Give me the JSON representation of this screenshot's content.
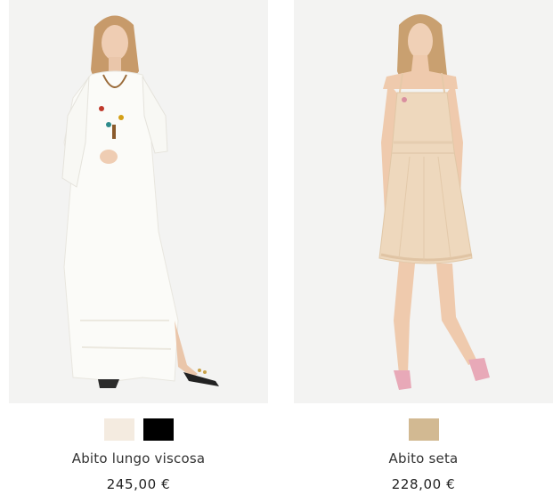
{
  "products": [
    {
      "name": "Abito lungo viscosa",
      "price": "245,00 €",
      "image_icon": "model-white-long-dress-photo",
      "swatches": [
        {
          "color": "#f4ebe0",
          "name": "ivory-swatch"
        },
        {
          "color": "#000000",
          "name": "black-swatch"
        }
      ]
    },
    {
      "name": "Abito seta",
      "price": "228,00 €",
      "image_icon": "model-beige-slip-dress-photo",
      "swatches": [
        {
          "color": "#d2b992",
          "name": "beige-swatch"
        }
      ]
    }
  ]
}
